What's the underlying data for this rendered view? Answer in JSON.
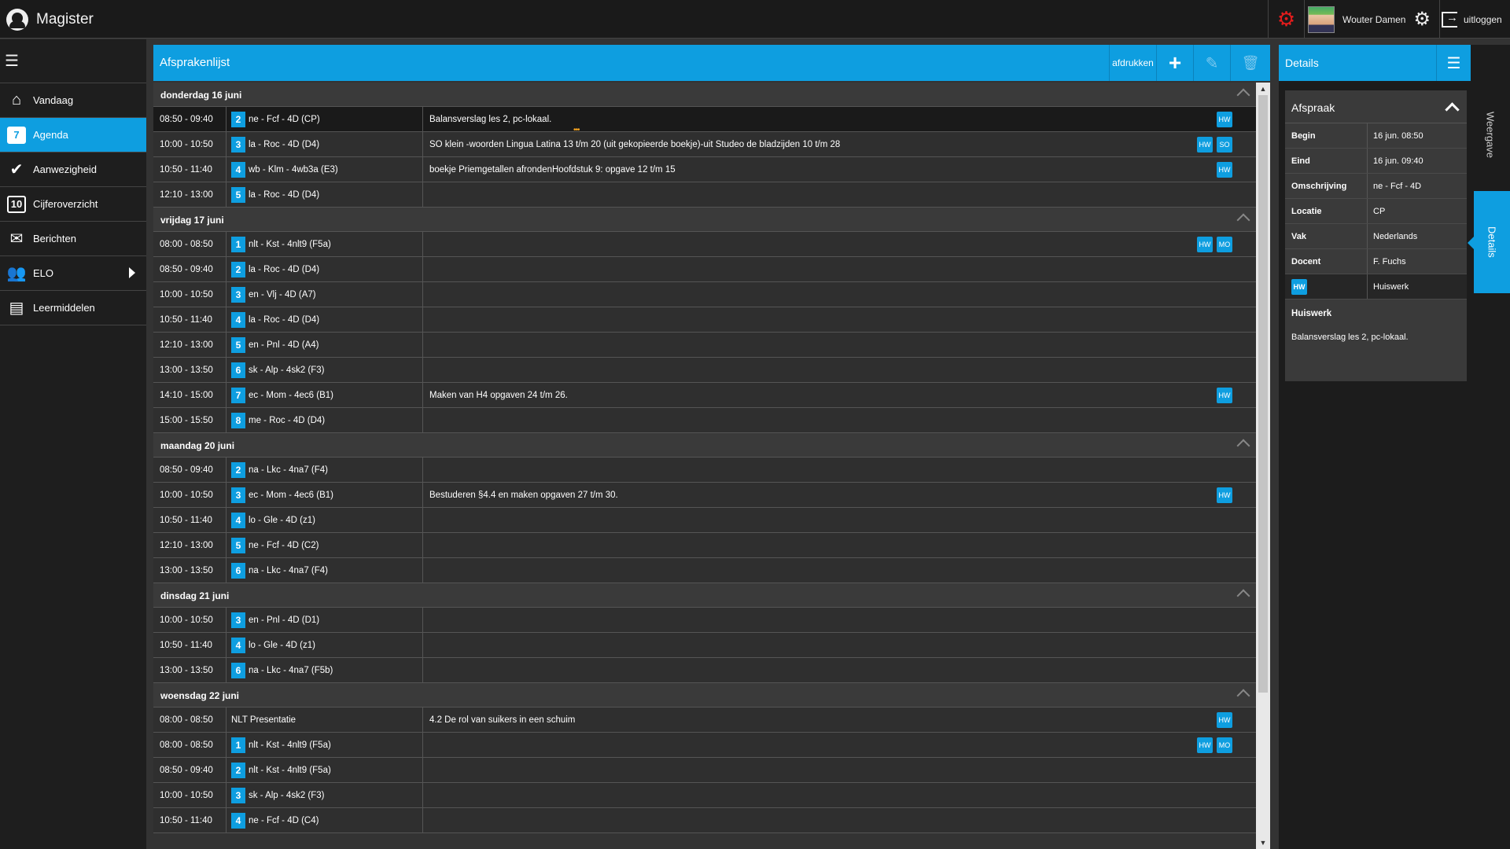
{
  "app": {
    "name": "Magister"
  },
  "topbar": {
    "user_name": "Wouter Damen",
    "logout_label": "uitloggen"
  },
  "sidebar": {
    "items": [
      {
        "label": "Vandaag",
        "icon": "home-icon"
      },
      {
        "label": "Agenda",
        "icon": "calendar-icon",
        "icon_text": "7",
        "active": true
      },
      {
        "label": "Aanwezigheid",
        "icon": "check-icon"
      },
      {
        "label": "Cijferoverzicht",
        "icon": "grades-icon",
        "icon_text": "10"
      },
      {
        "label": "Berichten",
        "icon": "mail-icon"
      },
      {
        "label": "ELO",
        "icon": "users-icon"
      },
      {
        "label": "Leermiddelen",
        "icon": "books-icon"
      }
    ]
  },
  "main": {
    "title": "Afsprakenlijst",
    "print_label": "afdrukken"
  },
  "days": [
    {
      "label": "donderdag 16 juni",
      "rows": [
        {
          "time": "08:50 - 09:40",
          "num": "2",
          "lesson": "ne - Fcf - 4D (CP)",
          "desc": "Balansverslag les 2, pc-lokaal.",
          "badges": [
            "HW"
          ]
        },
        {
          "time": "10:00 - 10:50",
          "num": "3",
          "lesson": "la - Roc - 4D (D4)",
          "desc": "SO klein -woorden Lingua Latina 13 t/m 20 (uit gekopieerde boekje)-uit Studeo de bladzijden 10 t/m 28",
          "badges": [
            "HW",
            "SO"
          ]
        },
        {
          "time": "10:50 - 11:40",
          "num": "4",
          "lesson": "wb - Klm - 4wb3a (E3)",
          "desc": "boekje Priemgetallen afrondenHoofdstuk 9: opgave 12 t/m 15",
          "badges": [
            "HW"
          ]
        },
        {
          "time": "12:10 - 13:00",
          "num": "5",
          "lesson": "la - Roc - 4D (D4)",
          "desc": "",
          "badges": []
        }
      ]
    },
    {
      "label": "vrijdag 17 juni",
      "rows": [
        {
          "time": "08:00 - 08:50",
          "num": "1",
          "lesson": "nlt - Kst - 4nlt9 (F5a)",
          "desc": "",
          "badges": [
            "HW",
            "MO"
          ]
        },
        {
          "time": "08:50 - 09:40",
          "num": "2",
          "lesson": "la - Roc - 4D (D4)",
          "desc": "",
          "badges": []
        },
        {
          "time": "10:00 - 10:50",
          "num": "3",
          "lesson": "en - Vlj - 4D (A7)",
          "desc": "",
          "badges": []
        },
        {
          "time": "10:50 - 11:40",
          "num": "4",
          "lesson": "la - Roc - 4D (D4)",
          "desc": "",
          "badges": []
        },
        {
          "time": "12:10 - 13:00",
          "num": "5",
          "lesson": "en - Pnl - 4D (A4)",
          "desc": "",
          "badges": []
        },
        {
          "time": "13:00 - 13:50",
          "num": "6",
          "lesson": "sk - Alp - 4sk2 (F3)",
          "desc": "",
          "badges": []
        },
        {
          "time": "14:10 - 15:00",
          "num": "7",
          "lesson": "ec - Mom - 4ec6 (B1)",
          "desc": "Maken van H4 opgaven 24 t/m 26.",
          "badges": [
            "HW"
          ]
        },
        {
          "time": "15:00 - 15:50",
          "num": "8",
          "lesson": "me - Roc - 4D (D4)",
          "desc": "",
          "badges": []
        }
      ]
    },
    {
      "label": "maandag 20 juni",
      "rows": [
        {
          "time": "08:50 - 09:40",
          "num": "2",
          "lesson": "na - Lkc - 4na7 (F4)",
          "desc": "",
          "badges": []
        },
        {
          "time": "10:00 - 10:50",
          "num": "3",
          "lesson": "ec - Mom - 4ec6 (B1)",
          "desc": "Bestuderen §4.4 en maken opgaven 27 t/m 30.",
          "badges": [
            "HW"
          ]
        },
        {
          "time": "10:50 - 11:40",
          "num": "4",
          "lesson": "lo - Gle - 4D (z1)",
          "desc": "",
          "badges": []
        },
        {
          "time": "12:10 - 13:00",
          "num": "5",
          "lesson": "ne - Fcf - 4D (C2)",
          "desc": "",
          "badges": []
        },
        {
          "time": "13:00 - 13:50",
          "num": "6",
          "lesson": "na - Lkc - 4na7 (F4)",
          "desc": "",
          "badges": []
        }
      ]
    },
    {
      "label": "dinsdag 21 juni",
      "rows": [
        {
          "time": "10:00 - 10:50",
          "num": "3",
          "lesson": "en - Pnl - 4D (D1)",
          "desc": "",
          "badges": []
        },
        {
          "time": "10:50 - 11:40",
          "num": "4",
          "lesson": "lo - Gle - 4D (z1)",
          "desc": "",
          "badges": []
        },
        {
          "time": "13:00 - 13:50",
          "num": "6",
          "lesson": "na - Lkc - 4na7 (F5b)",
          "desc": "",
          "badges": []
        }
      ]
    },
    {
      "label": "woensdag 22 juni",
      "rows": [
        {
          "time": "08:00 - 08:50",
          "num": "",
          "lesson": "NLT Presentatie",
          "desc": "4.2 De rol van suikers in een schuim",
          "badges": [
            "HW"
          ]
        },
        {
          "time": "08:00 - 08:50",
          "num": "1",
          "lesson": "nlt - Kst - 4nlt9 (F5a)",
          "desc": "",
          "badges": [
            "HW",
            "MO"
          ]
        },
        {
          "time": "08:50 - 09:40",
          "num": "2",
          "lesson": "nlt - Kst - 4nlt9 (F5a)",
          "desc": "",
          "badges": []
        },
        {
          "time": "10:00 - 10:50",
          "num": "3",
          "lesson": "sk - Alp - 4sk2 (F3)",
          "desc": "",
          "badges": []
        },
        {
          "time": "10:50 - 11:40",
          "num": "4",
          "lesson": "ne - Fcf - 4D (C4)",
          "desc": "",
          "badges": []
        }
      ]
    }
  ],
  "details": {
    "title": "Details",
    "card_title": "Afspraak",
    "fields": [
      {
        "key": "Begin",
        "value": "16 jun. 08:50"
      },
      {
        "key": "Eind",
        "value": "16 jun. 09:40"
      },
      {
        "key": "Omschrijving",
        "value": "ne - Fcf - 4D"
      },
      {
        "key": "Locatie",
        "value": "CP"
      },
      {
        "key": "Vak",
        "value": "Nederlands"
      },
      {
        "key": "Docent",
        "value": "F. Fuchs"
      }
    ],
    "hw_badge": "HW",
    "hw_value": "Huiswerk",
    "homework_title": "Huiswerk",
    "homework_text": "Balansverslag les 2, pc-lokaal."
  },
  "rail": {
    "tab_weergave": "Weergave",
    "tab_details": "Details"
  },
  "colors": {
    "accent": "#0e9ee0",
    "alert": "#e41c1c",
    "background": "#333333"
  }
}
